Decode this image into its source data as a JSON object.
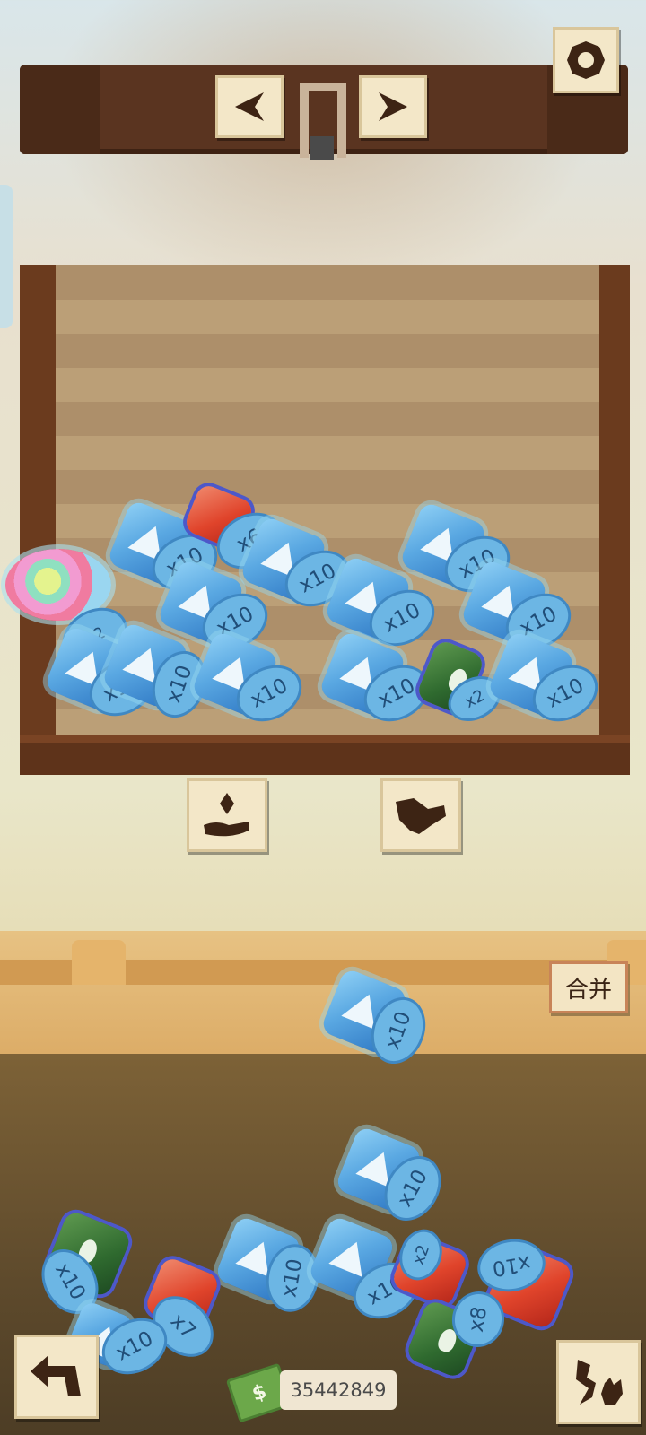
{
  "top_bar": {
    "prev_icon": "arrow-left-icon",
    "next_icon": "arrow-right-icon",
    "settings_icon": "gear-icon"
  },
  "display_case": {
    "gems": [
      {
        "color": "blue",
        "multiplier": "x10"
      },
      {
        "color": "red",
        "multiplier": "x6"
      },
      {
        "color": "blue",
        "multiplier": "x10"
      },
      {
        "color": "blue",
        "multiplier": "x10"
      },
      {
        "color": "blue",
        "multiplier": "x10"
      },
      {
        "color": "blue",
        "multiplier": "x10"
      },
      {
        "color": "blue",
        "multiplier": "x10"
      },
      {
        "color": "blue",
        "multiplier": "x10"
      },
      {
        "color": "blue",
        "multiplier": "x10"
      },
      {
        "color": "blue",
        "multiplier": "x10"
      },
      {
        "color": "blue",
        "multiplier": "x10"
      },
      {
        "color": "green",
        "multiplier": "x2"
      },
      {
        "color": "blue",
        "multiplier": "x10"
      },
      {
        "color": "egg",
        "multiplier": "x2"
      }
    ]
  },
  "actions": {
    "give_icon": "hand-give-icon",
    "trade_icon": "handshake-icon"
  },
  "crate": {
    "merge_label": "合并",
    "held_gem": {
      "color": "blue",
      "multiplier": "x10"
    },
    "gems": [
      {
        "color": "blue",
        "multiplier": "x10"
      },
      {
        "color": "green",
        "multiplier": "x10"
      },
      {
        "color": "blue",
        "multiplier": "x10"
      },
      {
        "color": "blue",
        "multiplier": "x10"
      },
      {
        "color": "red",
        "multiplier": "x2"
      },
      {
        "color": "red",
        "multiplier": "x10"
      },
      {
        "color": "red",
        "multiplier": "x7"
      },
      {
        "color": "blue",
        "multiplier": "x10"
      },
      {
        "color": "green",
        "multiplier": "x8"
      }
    ]
  },
  "bottom": {
    "undo_icon": "undo-arrow-icon",
    "animal_icon": "animal-icon",
    "money_value": "35442849"
  }
}
